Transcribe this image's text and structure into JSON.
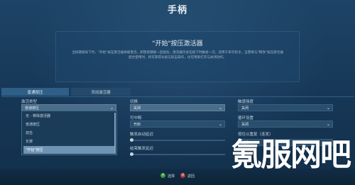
{
  "window": {
    "title": "手柄"
  },
  "panel": {
    "title": "\"开始\"按压激活器",
    "desc": "当按键被按下时，\"开始\"按压激活器将被激活。即使按键被一直按住，激活器仅会在按下时触发一次。适用于单次指令。当需要与\"释放\"按压激活器配合使用时，将可获得长按与轻击操作，也可用来打开与关闭动作。"
  },
  "tabs": [
    {
      "label": "普通按压"
    },
    {
      "label": "添加激活器"
    }
  ],
  "left": {
    "activation_type_label": "激活类型",
    "activation_type_value": "普通按压",
    "options": [
      "无 - 移除激活器",
      "普通按压",
      "双击",
      "长按",
      "\"开始\"按压"
    ],
    "selected_index": 4
  },
  "middle": {
    "toggle_label": "切换",
    "toggle_value": "关闭",
    "interruptible_label": "可中断",
    "interruptible_value": "开启",
    "start_delay_label": "触发启动延迟",
    "end_delay_label": "结束触发延迟",
    "start_delay_level": 0,
    "end_delay_level": 0
  },
  "right": {
    "haptic_label": "触感强度",
    "haptic_value": "关闭",
    "cycle_label": "循环设置",
    "cycle_value": "关闭",
    "repeat_label": "按住以重复（连发）",
    "repeat_value": "关闭"
  },
  "footer": {
    "a_glyph": "A",
    "a_label": "选择",
    "b_glyph": "B",
    "b_label": "返回"
  },
  "watermark": "氪服网吧"
}
